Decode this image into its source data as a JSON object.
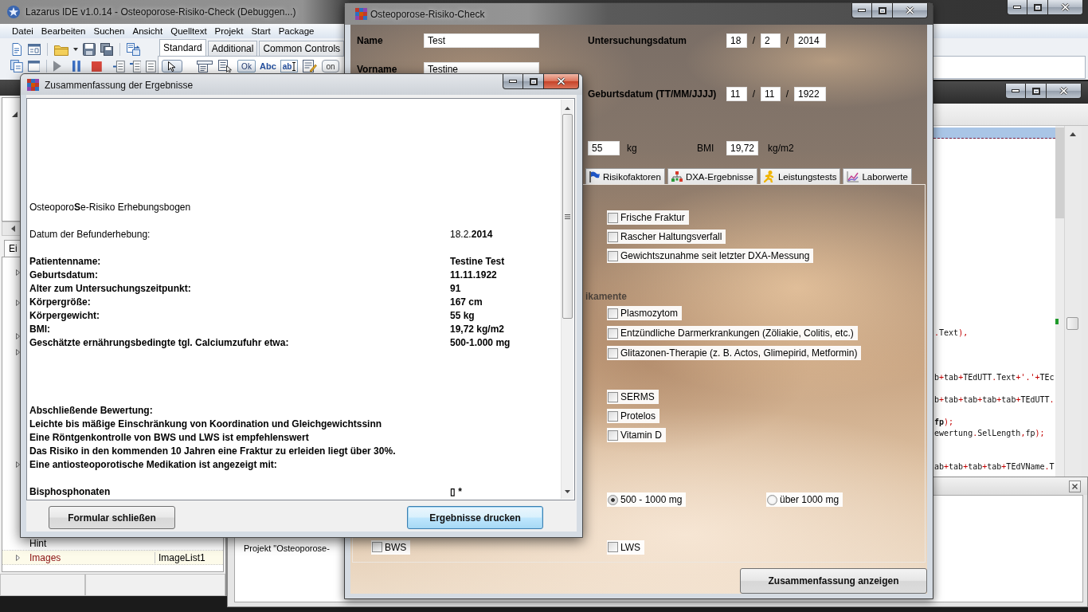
{
  "ide": {
    "title": "Lazarus IDE v1.0.14 - Osteoporose-Risiko-Check (Debuggen...)",
    "menu": [
      "Datei",
      "Bearbeiten",
      "Suchen",
      "Ansicht",
      "Quelltext",
      "Projekt",
      "Start",
      "Package"
    ],
    "palette_tabs": [
      {
        "label": "Standard",
        "selected": true
      },
      {
        "label": "Additional",
        "selected": false
      },
      {
        "label": "Common Controls",
        "selected": false
      }
    ],
    "palette": [
      {
        "kind": "pointer",
        "selected": true
      },
      {
        "kind": "menu",
        "selected": false
      },
      {
        "kind": "popup",
        "selected": false
      },
      {
        "kind": "button",
        "text": "Ok",
        "selected": false
      },
      {
        "kind": "label",
        "text": "Abc",
        "selected": false
      },
      {
        "kind": "edit",
        "text": "ab",
        "selected": false
      },
      {
        "kind": "memo",
        "selected": false
      },
      {
        "kind": "toggle",
        "text": "on",
        "selected": false
      }
    ]
  },
  "object_inspector": {
    "tab": "Ei",
    "properties": [
      {
        "name": "Hint",
        "kind": "plain"
      },
      {
        "name": "Images",
        "value": "ImageList1",
        "kind": "reference"
      }
    ]
  },
  "source_editor": {
    "lines": [
      ".Text),",
      "b+tab+TEdUTT.Text+'.'+TEc",
      "b+tab+tab+tab+tab+TEdUTT.",
      "**fp**);",
      "ewertung.SelLength,fp);",
      "ab+tab+tab+tab+TEdVName.T"
    ]
  },
  "messages": {
    "text": "Projekt \"Osteoporose-"
  },
  "form": {
    "title": "Osteoporose-Risiko-Check",
    "name": {
      "label": "Name",
      "value": "Test"
    },
    "first_name": {
      "label": "Vorname",
      "value": "Testine"
    },
    "dates": [
      {
        "label": "Untersuchungsdatum",
        "day": "18",
        "month": "2",
        "year": "2014",
        "separators": [
          "/",
          "/"
        ]
      },
      {
        "label": "Geburtsdatum (TT/MM/JJJJ)",
        "day": "11",
        "month": "11",
        "year": "1922",
        "separators": [
          "/",
          "/"
        ]
      }
    ],
    "weight": {
      "value": "55",
      "unit": "kg"
    },
    "bmi": {
      "label": "BMI",
      "value": "19,72",
      "unit": "kg/m2"
    },
    "tabs": [
      {
        "label": "Risikofaktoren",
        "selected": false
      },
      {
        "label": "DXA-Ergebnisse",
        "selected": false
      },
      {
        "label": "Leistungstests",
        "selected": false
      },
      {
        "label": "Laborwerte",
        "selected": false
      }
    ],
    "page": {
      "groups": [
        {
          "items": [
            {
              "label": "Frische Fraktur",
              "checked": false
            },
            {
              "label": "Rascher Haltungsverfall",
              "checked": false
            },
            {
              "label": "Gewichtszunahme seit letzter DXA-Messung",
              "checked": false
            }
          ]
        },
        {
          "heading": "ikamente",
          "items": [
            {
              "label": "Plasmozytom",
              "checked": false
            },
            {
              "label": "Entzündliche Darmerkrankungen (Zöliakie, Colitis, etc.)",
              "checked": false
            },
            {
              "label": "Glitazonen-Therapie (z. B. Actos, Glimepirid, Metformin)",
              "checked": false
            }
          ]
        },
        {
          "items": [
            {
              "label": "SERMS",
              "checked": false
            },
            {
              "label": "Protelos",
              "checked": false
            },
            {
              "label": "Vitamin D",
              "checked": false
            }
          ]
        }
      ],
      "calcium": [
        {
          "label": "500 - 1000 mg",
          "selected": true
        },
        {
          "label": "über 1000 mg",
          "selected": false
        }
      ],
      "spine": [
        {
          "label": "BWS",
          "checked": false
        },
        {
          "label": "LWS",
          "checked": false
        }
      ]
    },
    "button": "Zusammenfassung anzeigen"
  },
  "dialog": {
    "title": "Zusammenfassung der Ergebnisse",
    "report": {
      "heading": "Osteoporo**S**e-Risiko Erhebungsbogen",
      "exam_date": {
        "label": "Datum der Befunderhebung:",
        "value": "18.2.**2014**"
      },
      "patient": [
        {
          "label": "Patientenname:",
          "value": "Testine Test"
        },
        {
          "label": "Geburtsdatum:",
          "value": "11.11.1922"
        },
        {
          "label": "Alter zum Untersuchungszeitpunkt:",
          "value": "91"
        },
        {
          "label": "Körpergröße:",
          "value": "167 cm"
        },
        {
          "label": "Körpergewicht:",
          "value": "55 kg"
        },
        {
          "label": "BMI:",
          "value": "19,72 kg/m2"
        },
        {
          "label": "Geschätzte ernährungsbedingte tgl. Calciumzufuhr etwa:",
          "value": "500-1.000 mg"
        }
      ],
      "assessment": [
        "Abschließende Bewertung:",
        "Leichte bis mäßige Einschränkung von Koordination und Gleichgewichtssinn",
        "Eine Röntgenkontrolle von BWS und LWS ist empfehlenswert",
        "Das Risiko in den kommenden 10 Jahren eine Fraktur zu erleiden liegt über 30%.",
        "Eine antiosteoporotische Medikation ist angezeigt mit:"
      ],
      "medication": [
        {
          "label": "Bisphosphonaten",
          "value": "▯ *"
        }
      ]
    },
    "buttons": [
      {
        "label": "Formular schließen",
        "focused": false
      },
      {
        "label": "Ergebnisse drucken",
        "focused": true
      }
    ]
  }
}
